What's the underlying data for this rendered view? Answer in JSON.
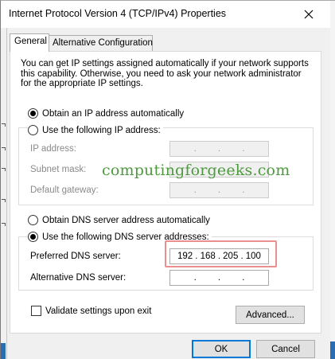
{
  "window": {
    "title": "Internet Protocol Version 4 (TCP/IPv4) Properties"
  },
  "tabs": [
    {
      "label": "General",
      "selected": true
    },
    {
      "label": "Alternative Configuration",
      "selected": false
    }
  ],
  "intro_text": "You can get IP settings assigned automatically if your network supports this capability. Otherwise, you need to ask your network administrator for the appropriate IP settings.",
  "ip_section": {
    "auto_label": "Obtain an IP address automatically",
    "auto_checked": true,
    "manual_label": "Use the following IP address:",
    "manual_checked": false,
    "fields": [
      {
        "label": "IP address:",
        "segments": [
          "",
          "",
          "",
          ""
        ],
        "enabled": false
      },
      {
        "label": "Subnet mask:",
        "segments": [
          "",
          "",
          "",
          ""
        ],
        "enabled": false
      },
      {
        "label": "Default gateway:",
        "segments": [
          "",
          "",
          "",
          ""
        ],
        "enabled": false
      }
    ]
  },
  "dns_section": {
    "auto_label": "Obtain DNS server address automatically",
    "auto_checked": false,
    "manual_label": "Use the following DNS server addresses:",
    "manual_checked": true,
    "preferred": {
      "label": "Preferred DNS server:",
      "segments": [
        "192",
        "168",
        "205",
        "100"
      ]
    },
    "alternate": {
      "label": "Alternative DNS server:",
      "segments": [
        "",
        "",
        "",
        ""
      ]
    }
  },
  "validate": {
    "label": "Validate settings upon exit",
    "checked": false
  },
  "buttons": {
    "advanced": "Advanced...",
    "ok": "OK",
    "cancel": "Cancel"
  },
  "watermark": "computingforgeeks.com",
  "colors": {
    "highlight": "#e98f8f",
    "watermark": "#4e9a3e",
    "accent": "#0078d7"
  }
}
